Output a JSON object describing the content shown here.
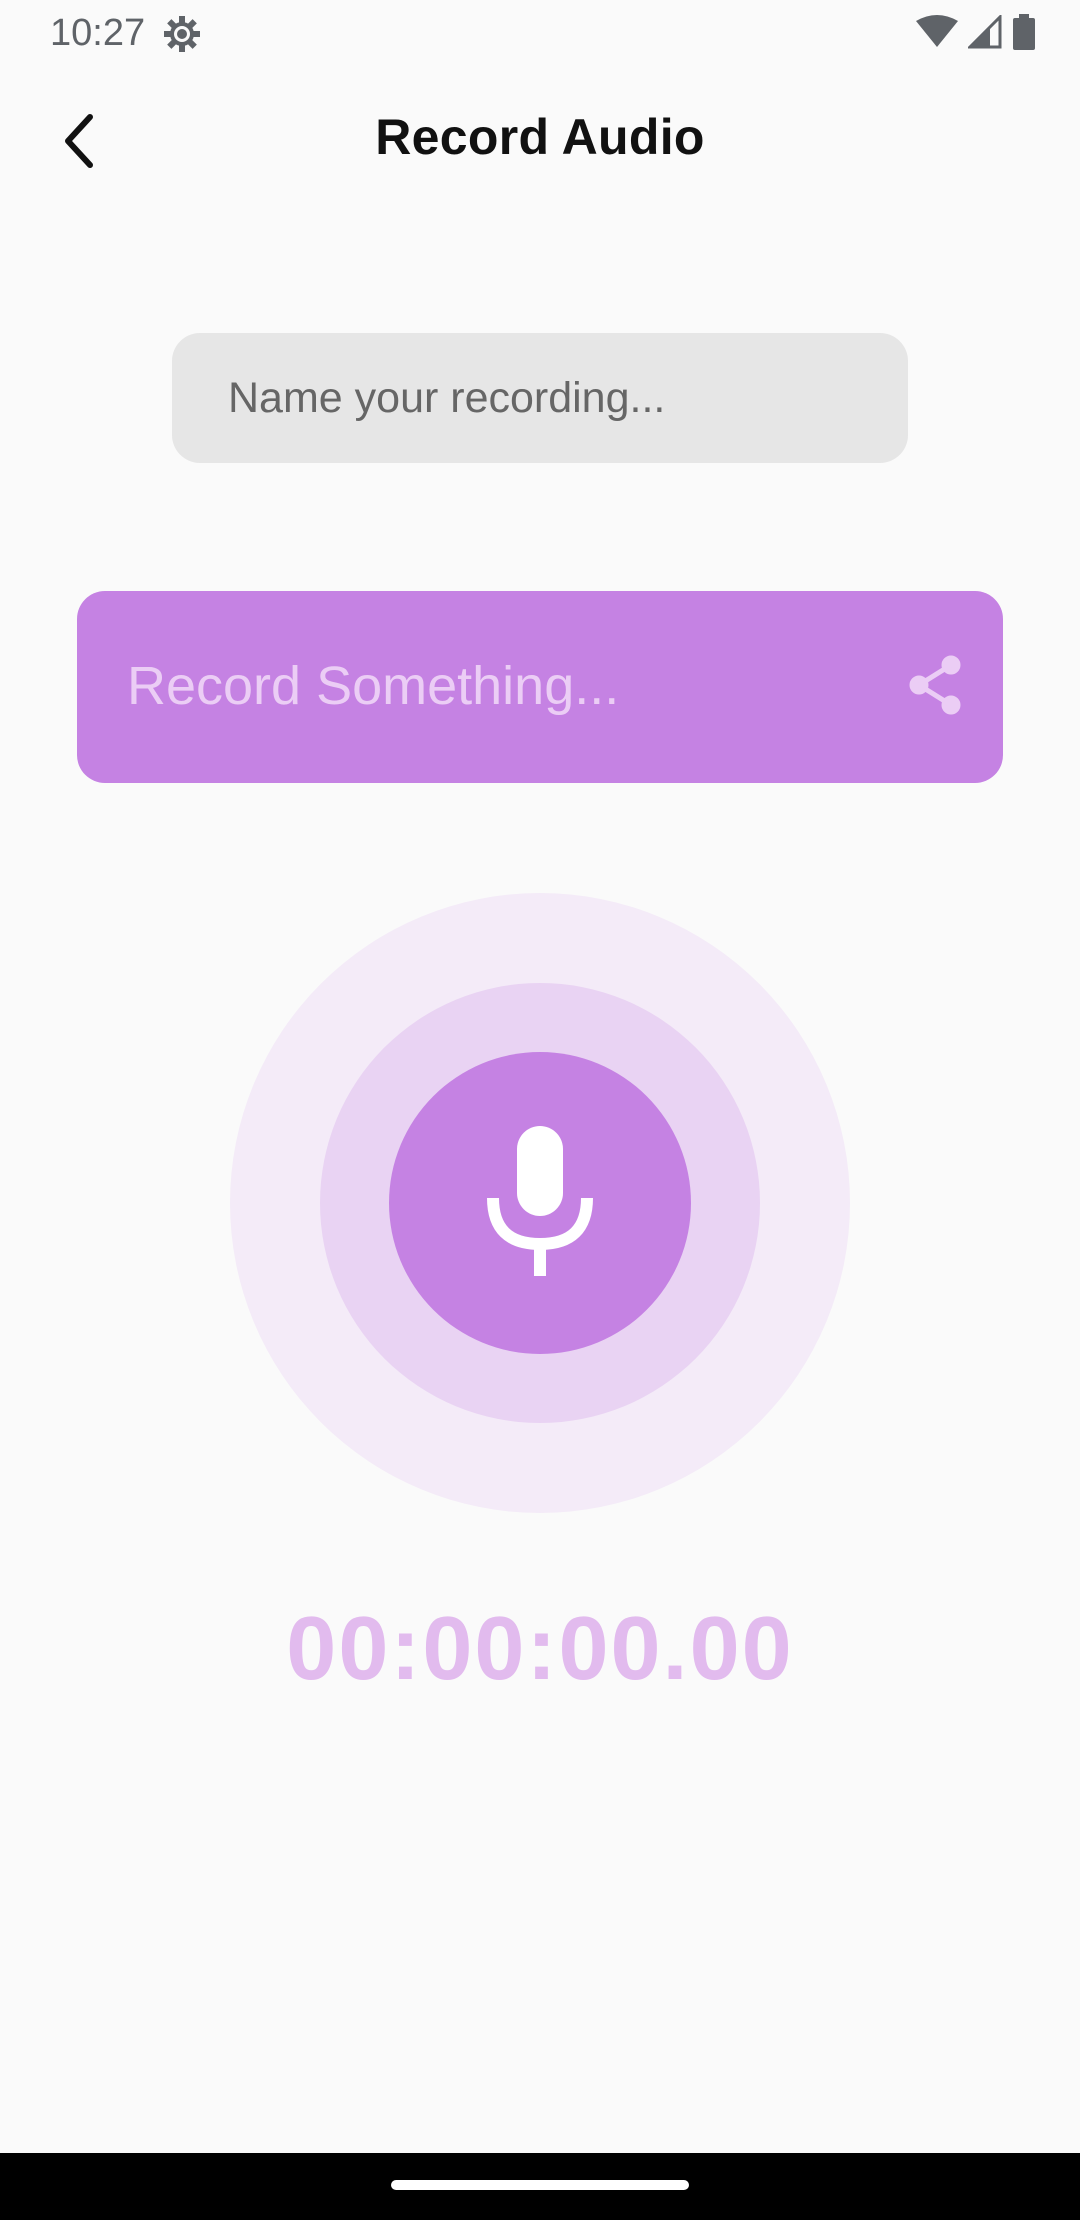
{
  "status_bar": {
    "time": "10:27",
    "icons": [
      "settings-gear-icon",
      "wifi-icon",
      "signal-icon",
      "battery-icon"
    ]
  },
  "header": {
    "title": "Record Audio",
    "back_icon": "back-arrow-icon"
  },
  "recording_name": {
    "placeholder": "Name your recording...",
    "value": ""
  },
  "record_card": {
    "label": "Record Something...",
    "share_icon": "share-icon"
  },
  "mic": {
    "icon": "microphone-icon"
  },
  "timer": {
    "value": "00:00:00.00"
  },
  "colors": {
    "accent": "#C582E3",
    "accent_light": "#E9D3F3",
    "accent_lighter": "#F4EBF8",
    "timer_text": "#E2BBEE",
    "input_bg": "#E6E6E6",
    "background": "#FAFAFA"
  }
}
